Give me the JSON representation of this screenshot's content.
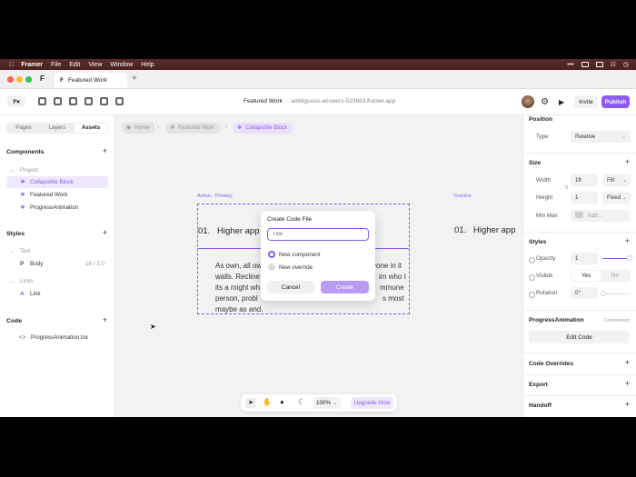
{
  "menubar": {
    "app": "Framer",
    "items": [
      "File",
      "Edit",
      "View",
      "Window",
      "Help"
    ]
  },
  "tabbar": {
    "tab_title": "Featured Work"
  },
  "toolbar": {
    "doc_title": "Featured Work",
    "doc_sub": "ambiguous-answers-523683.framer.app",
    "invite": "Invite",
    "publish": "Publish"
  },
  "left": {
    "tabs": [
      "Pages",
      "Layers",
      "Assets"
    ],
    "components_title": "Components",
    "project_label": "Project",
    "components": [
      "Collapsible Block",
      "Featured Work",
      "ProgressAnimation"
    ],
    "styles_title": "Styles",
    "text_label": "Text",
    "body_label": "Body",
    "body_meta": "18 / 3.0",
    "links_label": "Links",
    "link_label": "Link",
    "code_title": "Code",
    "code_file": "ProgressAnimation.tsx"
  },
  "canvas": {
    "breadcrumbs": [
      "Home",
      "Featured Work",
      "Collapsible Block"
    ],
    "active_label": "Active - Primary",
    "inactive_label": "Inactive",
    "num": "01.",
    "heading": "Higher app",
    "inactive_heading": "Higher app",
    "para": {
      "l1a": "As own, all ow",
      "l1b": "yone in it",
      "l2a": "walls. Recline",
      "l2b": "im who I",
      "l3a": "its a might wh",
      "l3b": "mmune",
      "l4a": "person, probl",
      "l4b": "s most",
      "l5": "maybe as and."
    }
  },
  "dialog": {
    "title": "Create Code File",
    "placeholder": "Title",
    "opt1": "New component",
    "opt2": "New override",
    "cancel": "Cancel",
    "create": "Create"
  },
  "bottombar": {
    "zoom": "100%",
    "upgrade": "Upgrade Now"
  },
  "right": {
    "position_title": "Position",
    "type_label": "Type",
    "type_value": "Relative",
    "size_title": "Size",
    "width_label": "Width",
    "width_value": "1fr",
    "width_mode": "Fill",
    "height_label": "Height",
    "height_value": "1",
    "height_mode": "Fixed",
    "minmax_label": "Min Max",
    "minmax_add": "Add...",
    "styles_title": "Styles",
    "opacity_label": "Opacity",
    "opacity_value": "1",
    "visible_label": "Visible",
    "visible_yes": "Yes",
    "visible_no": "No",
    "rotation_label": "Rotation",
    "rotation_value": "0°",
    "component_name": "ProgressAnimation",
    "component_tag": "Component",
    "edit_code": "Edit Code",
    "code_overrides": "Code Overrides",
    "export": "Export",
    "handoff": "Handoff"
  },
  "colors": {
    "accent": "#8c5cf0",
    "accent_light": "#b99bf5"
  }
}
